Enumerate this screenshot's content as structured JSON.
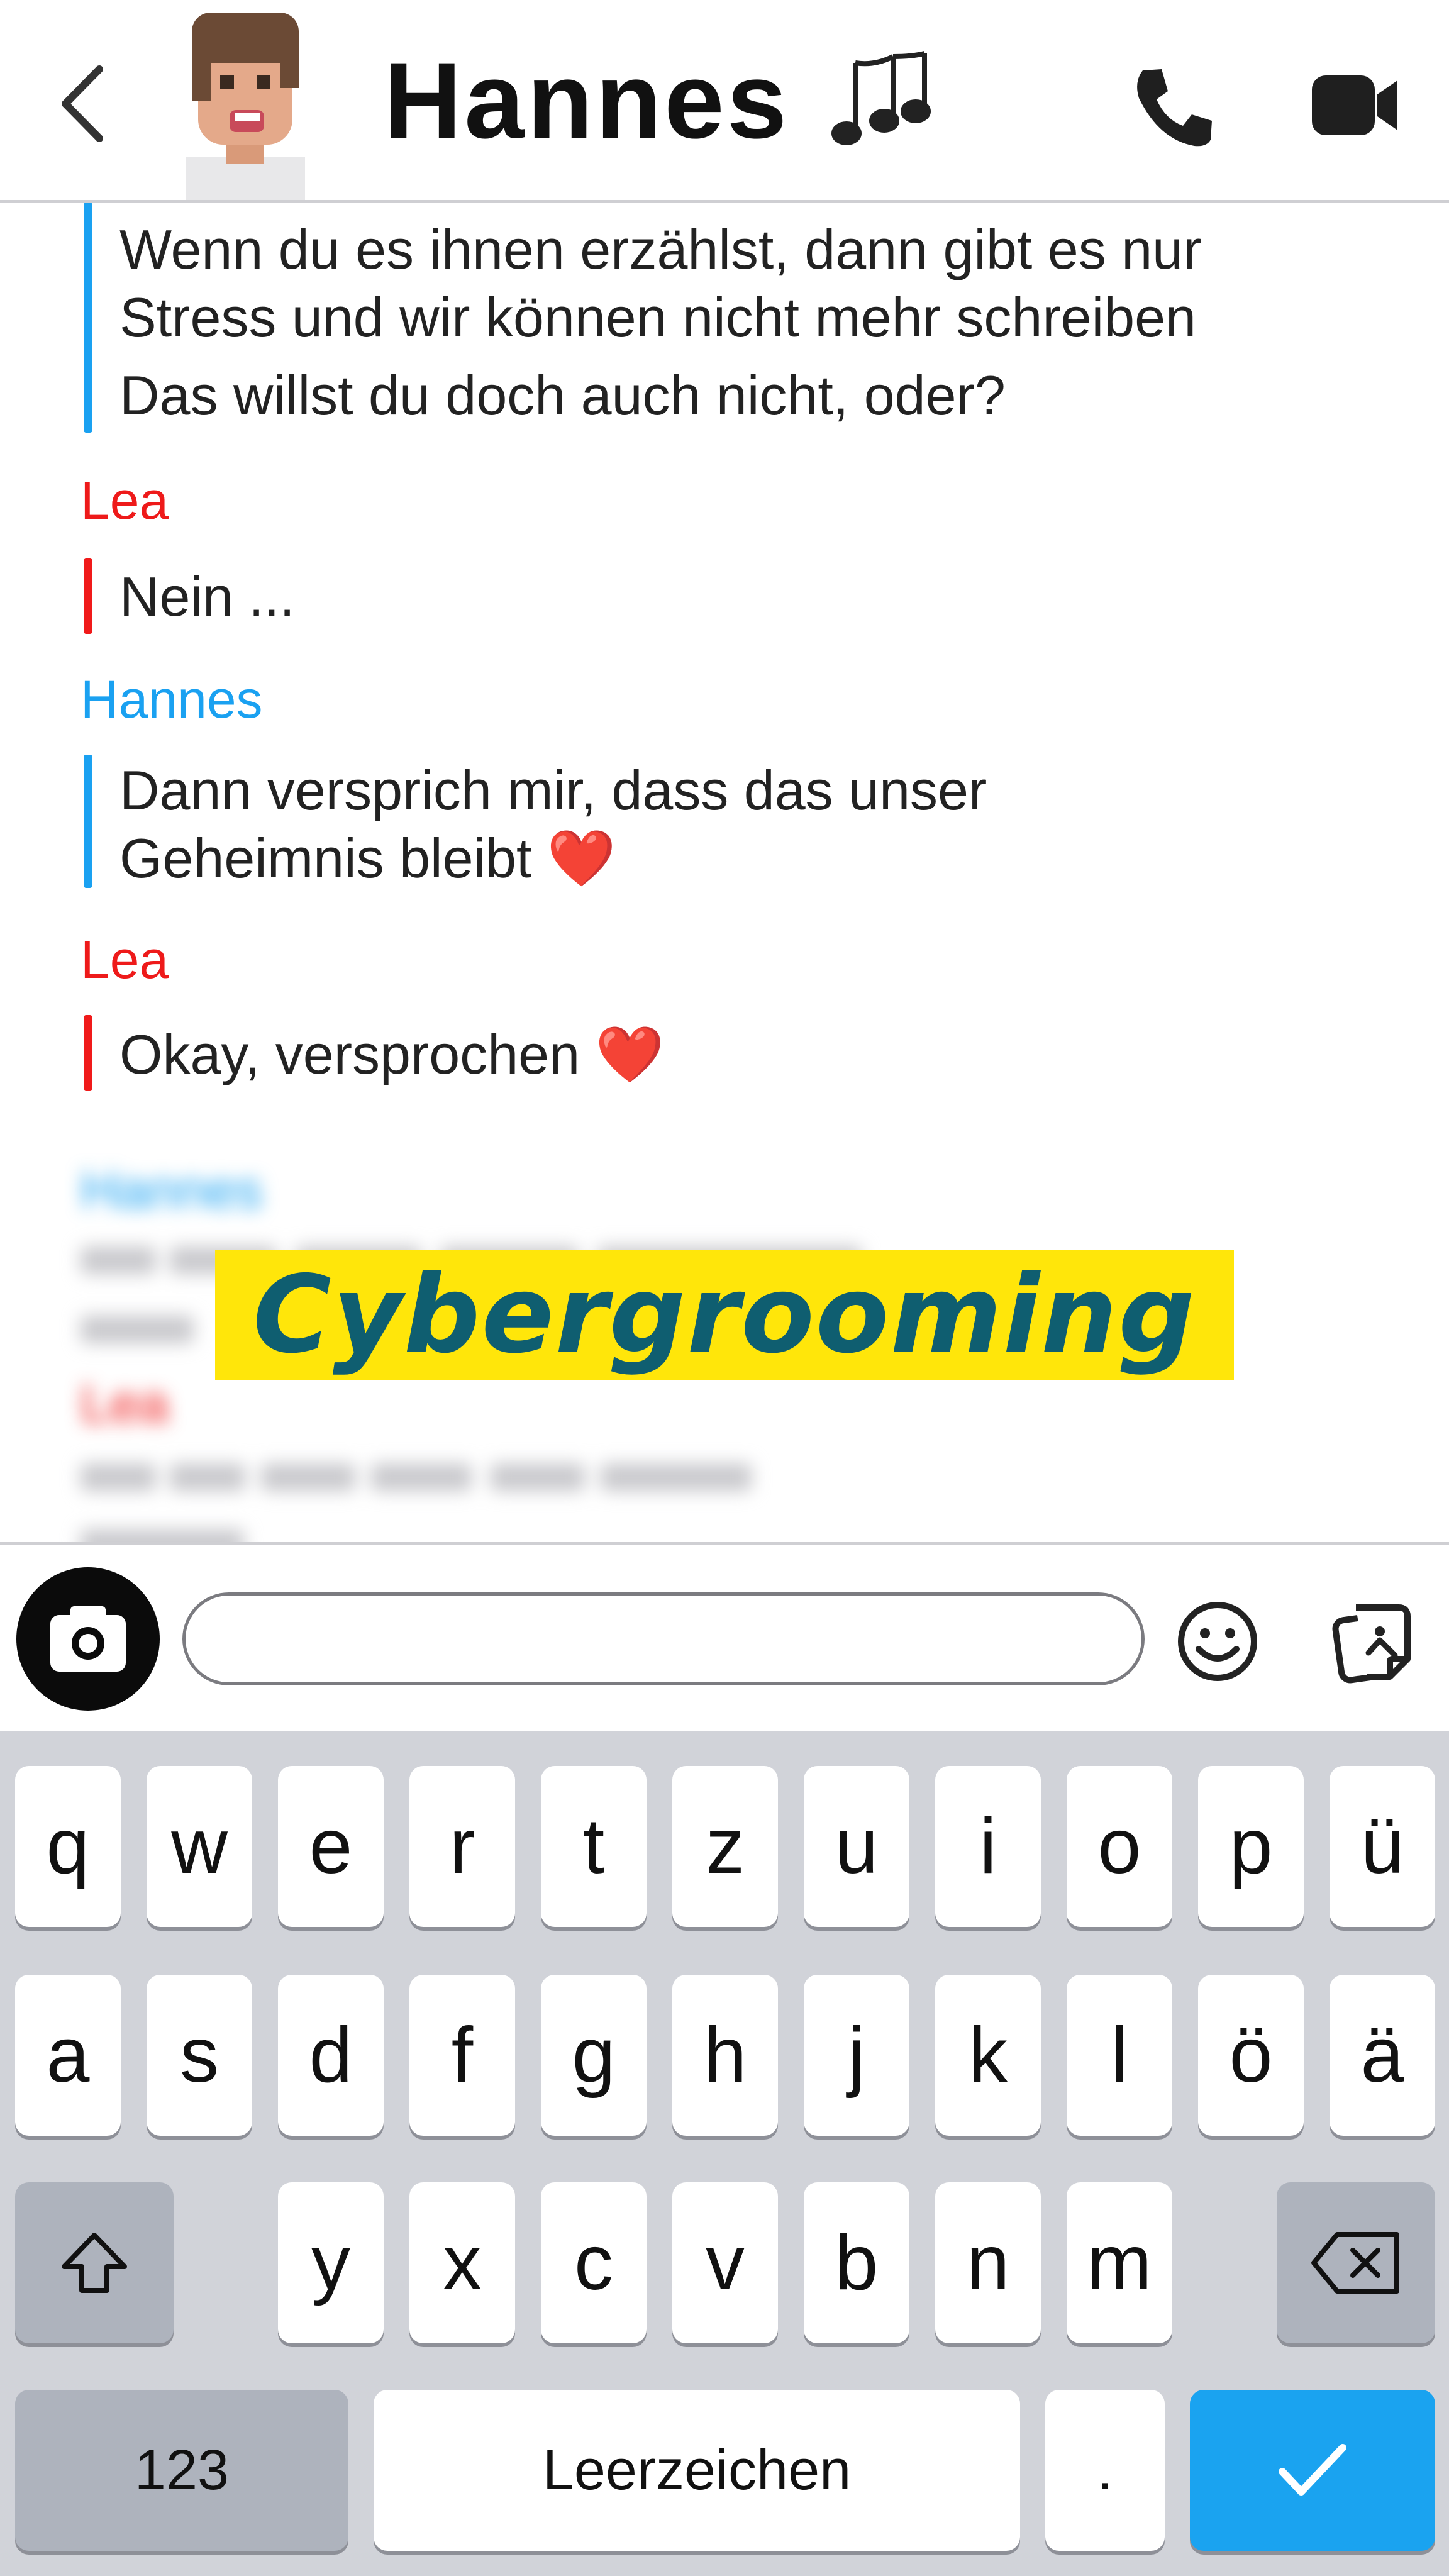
{
  "header": {
    "contact_name": "Hannes",
    "back_icon": "chevron-left-icon",
    "call_icon": "phone-icon",
    "video_icon": "video-camera-icon"
  },
  "messages": [
    {
      "sender": "Hannes",
      "lines": [
        "Wenn du es ihnen erzählst, dann gibt es nur",
        "Stress und wir können nicht mehr schreiben",
        "Das willst du doch auch nicht, oder?"
      ]
    },
    {
      "sender": "Lea",
      "lines": [
        "Nein ..."
      ]
    },
    {
      "sender": "Hannes",
      "lines": [
        "Dann versprich mir, dass das unser",
        "Geheimnis bleibt"
      ],
      "emoji": "❤️"
    },
    {
      "sender": "Lea",
      "lines": [
        "Okay, versprochen"
      ],
      "emoji": "❤️"
    }
  ],
  "blurred": {
    "sender_1": "Hannes",
    "sender_2": "Lea"
  },
  "banner": {
    "text": "Cybergrooming",
    "background": "#ffe60a",
    "color": "#0f5e70"
  },
  "composer": {
    "placeholder": "",
    "camera_icon": "camera-icon",
    "emoji_icon": "smiley-icon",
    "sticker_icon": "sticker-icon"
  },
  "keyboard": {
    "row1": [
      "q",
      "w",
      "e",
      "r",
      "t",
      "z",
      "u",
      "i",
      "o",
      "p",
      "ü"
    ],
    "row2": [
      "a",
      "s",
      "d",
      "f",
      "g",
      "h",
      "j",
      "k",
      "l",
      "ö",
      "ä"
    ],
    "row3": [
      "y",
      "x",
      "c",
      "v",
      "b",
      "n",
      "m"
    ],
    "numbers_label": "123",
    "space_label": "Leerzeichen",
    "period_label": ".",
    "enter_color": "#1aa3f0"
  },
  "colors": {
    "hannes": "#1aa1f1",
    "lea": "#ee1a1a"
  }
}
